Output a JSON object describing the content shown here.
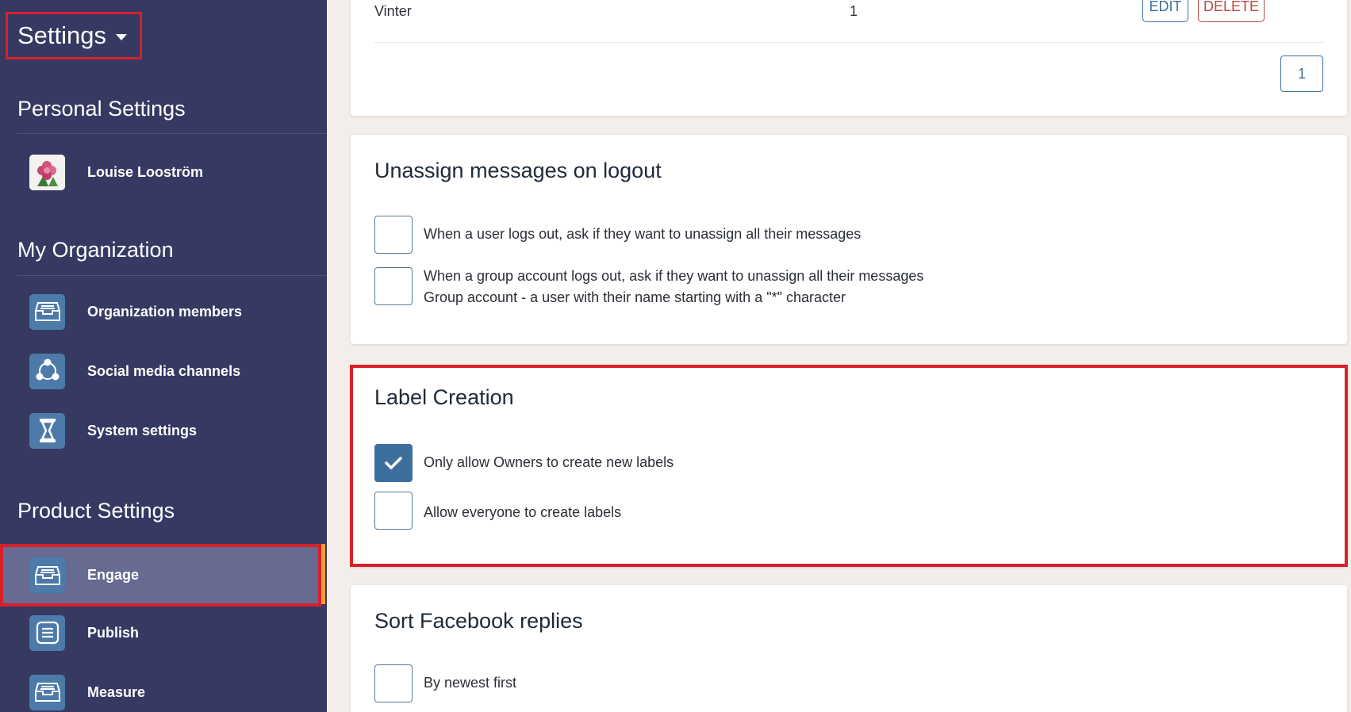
{
  "sidebar": {
    "title": "Settings",
    "personal_title": "Personal Settings",
    "user_name": "Louise Looström",
    "org_title": "My Organization",
    "org_items": [
      {
        "label": "Organization members",
        "icon": "inbox-icon"
      },
      {
        "label": "Social media channels",
        "icon": "share-network-icon"
      },
      {
        "label": "System settings",
        "icon": "hourglass-icon"
      }
    ],
    "product_title": "Product Settings",
    "product_items": [
      {
        "label": "Engage",
        "icon": "inbox-icon"
      },
      {
        "label": "Publish",
        "icon": "list-document-icon"
      },
      {
        "label": "Measure",
        "icon": "inbox-icon"
      }
    ]
  },
  "labels_table": {
    "row_name": "Vinter",
    "row_count": "1",
    "edit_label": "EDIT",
    "delete_label": "DELETE",
    "page": "1"
  },
  "unassign": {
    "title": "Unassign messages on logout",
    "option1": "When a user logs out, ask if they want to unassign all their messages",
    "option2_line1": "When a group account logs out, ask if they want to unassign all their messages",
    "option2_line2": "Group account - a user with their name starting with a \"*\" character"
  },
  "label_creation": {
    "title": "Label Creation",
    "option1": "Only allow Owners to create new labels",
    "option2": "Allow everyone to create labels"
  },
  "sort_facebook": {
    "title": "Sort Facebook replies",
    "option1": "By newest first"
  },
  "colors": {
    "sidebar_bg": "#363962",
    "accent": "#3d6f9e",
    "highlight": "#d8202c"
  }
}
